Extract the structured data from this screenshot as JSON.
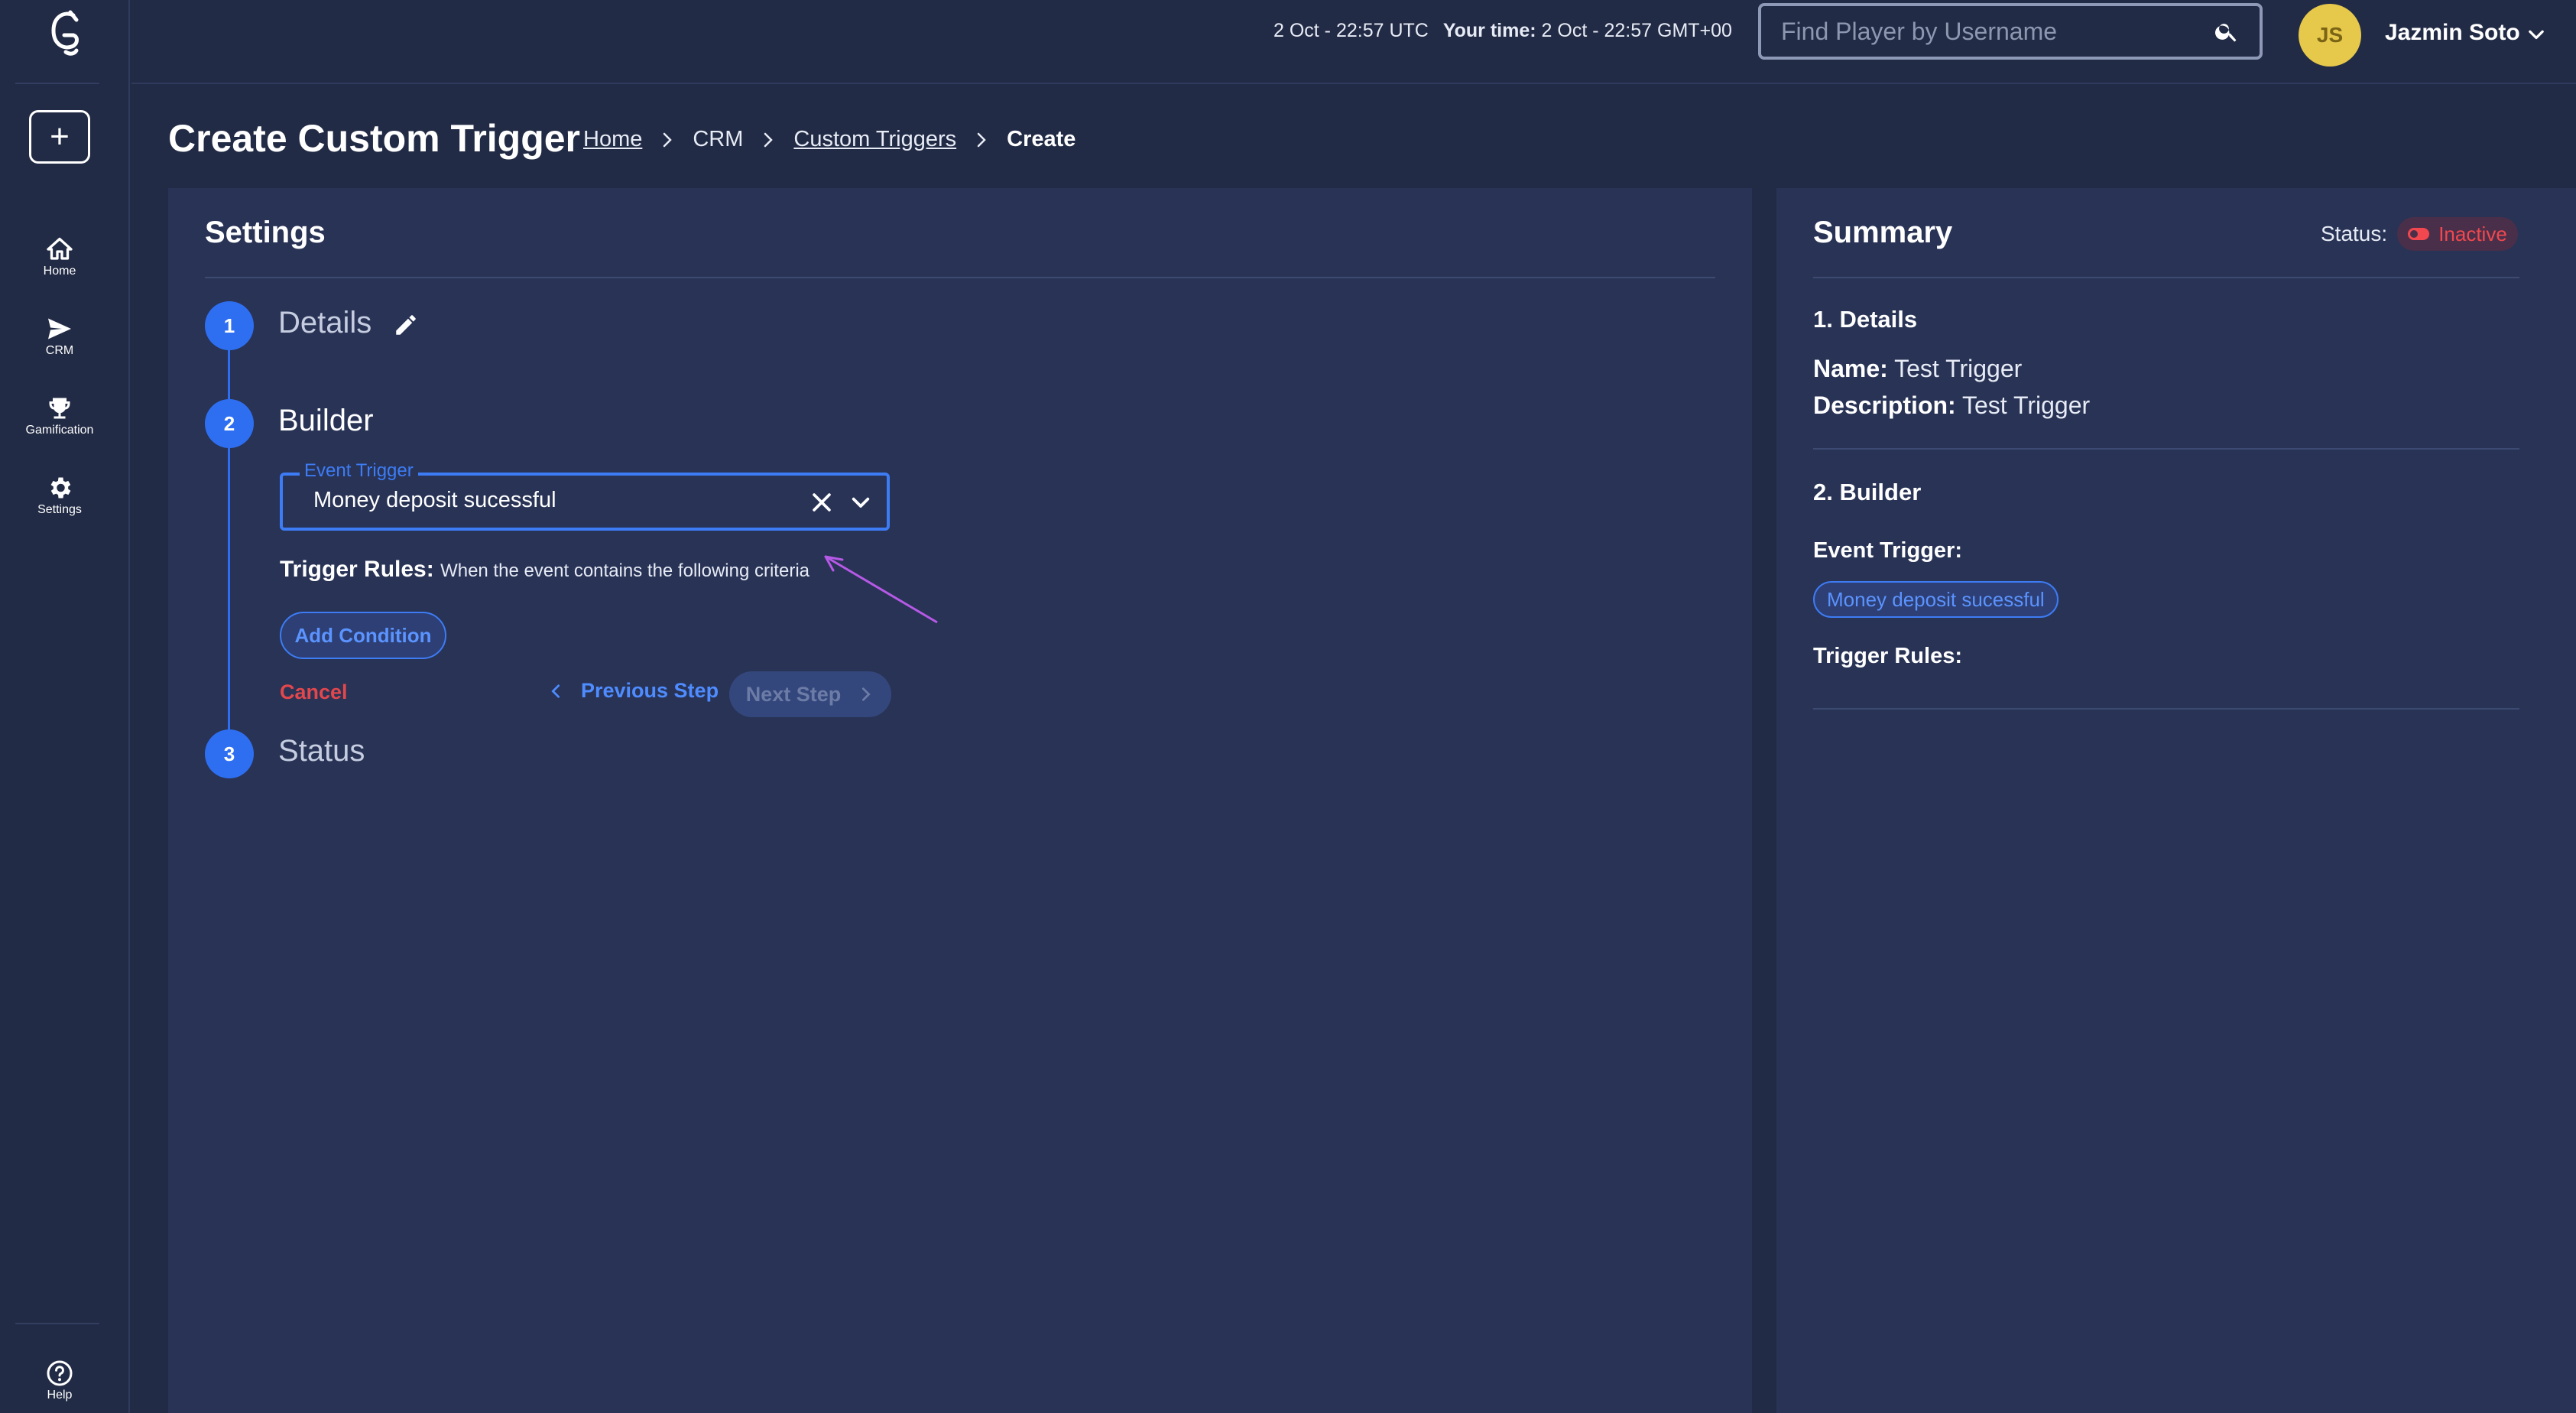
{
  "sidebar": {
    "add_label": "+",
    "items": [
      {
        "label": "Home",
        "icon": "home-icon"
      },
      {
        "label": "CRM",
        "icon": "send-icon"
      },
      {
        "label": "Gamification",
        "icon": "trophy-icon"
      },
      {
        "label": "Settings",
        "icon": "gear-icon"
      }
    ],
    "help_label": "Help"
  },
  "topbar": {
    "server_time": "2 Oct - 22:57 UTC",
    "your_time_label": "Your time:",
    "your_time": "2 Oct - 22:57 GMT+00",
    "search_placeholder": "Find Player by Username",
    "user_initials": "JS",
    "user_name": "Jazmin Soto"
  },
  "page": {
    "title": "Create Custom Trigger",
    "breadcrumb": [
      "Home",
      "CRM",
      "Custom Triggers",
      "Create"
    ]
  },
  "settings": {
    "title": "Settings",
    "steps": [
      {
        "number": "1",
        "title": "Details"
      },
      {
        "number": "2",
        "title": "Builder"
      },
      {
        "number": "3",
        "title": "Status"
      }
    ],
    "event_trigger_label": "Event Trigger",
    "event_trigger_value": "Money deposit sucessful",
    "trigger_rules_label": "Trigger Rules:",
    "trigger_rules_desc": "When the event contains the following criteria",
    "add_condition": "Add Condition",
    "cancel": "Cancel",
    "previous": "Previous Step",
    "next": "Next Step"
  },
  "summary": {
    "title": "Summary",
    "status_label": "Status:",
    "status_value": "Inactive",
    "details_heading": "1. Details",
    "name_label": "Name:",
    "name_value": "Test Trigger",
    "description_label": "Description:",
    "description_value": "Test Trigger",
    "builder_heading": "2. Builder",
    "event_trigger_label": "Event Trigger:",
    "event_trigger_value": "Money deposit sucessful",
    "trigger_rules_label": "Trigger Rules:"
  },
  "colors": {
    "background": "#222b45",
    "panel": "#283356",
    "accent": "#2e6ff2",
    "danger": "#e2474c",
    "avatar": "#e6c84a"
  }
}
